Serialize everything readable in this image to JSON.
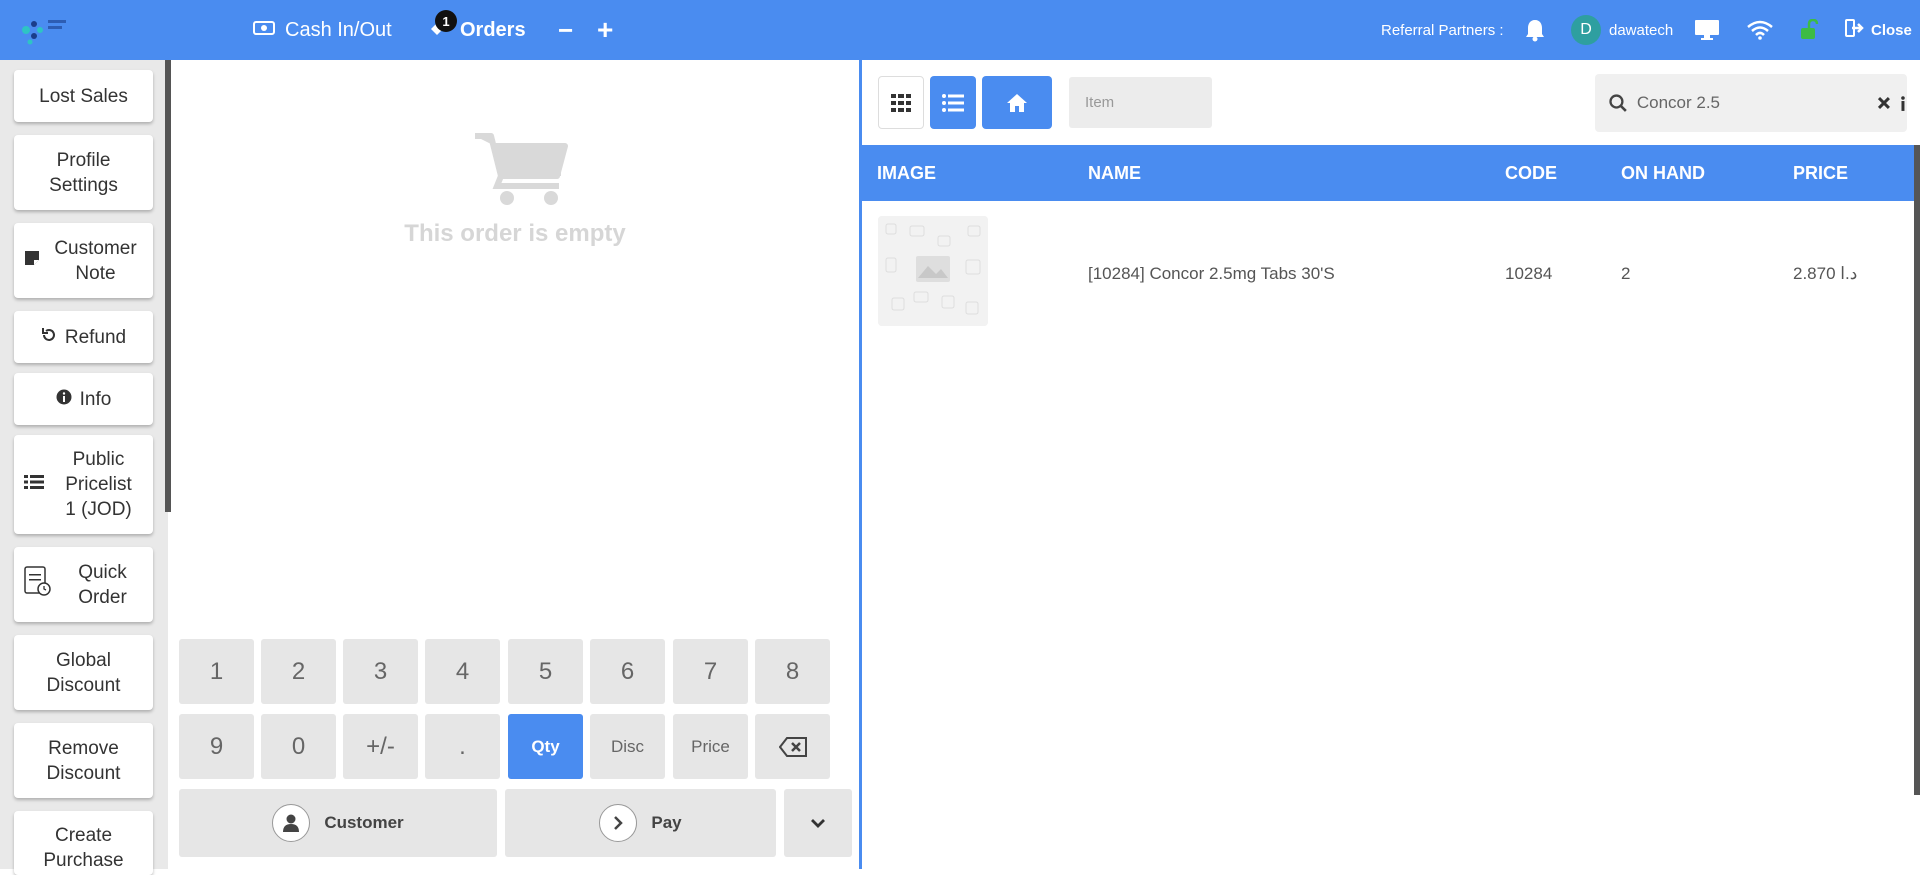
{
  "topbar": {
    "cash_label": "Cash In/Out",
    "orders_label": "Orders",
    "orders_count": "1",
    "minus": "−",
    "plus": "+",
    "referral_label": "Referral Partners :",
    "user_initial": "D",
    "user_name": "dawatech",
    "close_label": "Close"
  },
  "sidebar": {
    "items": [
      {
        "label": "Lost Sales"
      },
      {
        "label": "Profile Settings"
      },
      {
        "label": "Customer Note"
      },
      {
        "label": "Refund"
      },
      {
        "label": "Info"
      },
      {
        "label": "Public Pricelist 1 (JOD)"
      },
      {
        "label": "Quick Order"
      },
      {
        "label": "Global Discount"
      },
      {
        "label": "Remove Discount"
      },
      {
        "label": "Create Purchase"
      }
    ]
  },
  "order": {
    "empty_text": "This order is empty"
  },
  "numpad": {
    "row1": [
      "1",
      "2",
      "3",
      "4",
      "5",
      "6",
      "7",
      "8"
    ],
    "row2": [
      "9",
      "0",
      "+/-",
      ".",
      "Qty",
      "Disc",
      "Price"
    ],
    "customer_label": "Customer",
    "pay_label": "Pay"
  },
  "products": {
    "item_placeholder": "Item",
    "search_value": "Concor 2.5",
    "columns": [
      "IMAGE",
      "NAME",
      "CODE",
      "ON HAND",
      "PRICE"
    ],
    "rows": [
      {
        "name": "[10284] Concor 2.5mg Tabs 30'S",
        "code": "10284",
        "on_hand": "2",
        "price": "2.870 د.ا"
      }
    ]
  },
  "colors": {
    "accent": "#4a8cf0",
    "lock_green": "#3dbb45"
  }
}
